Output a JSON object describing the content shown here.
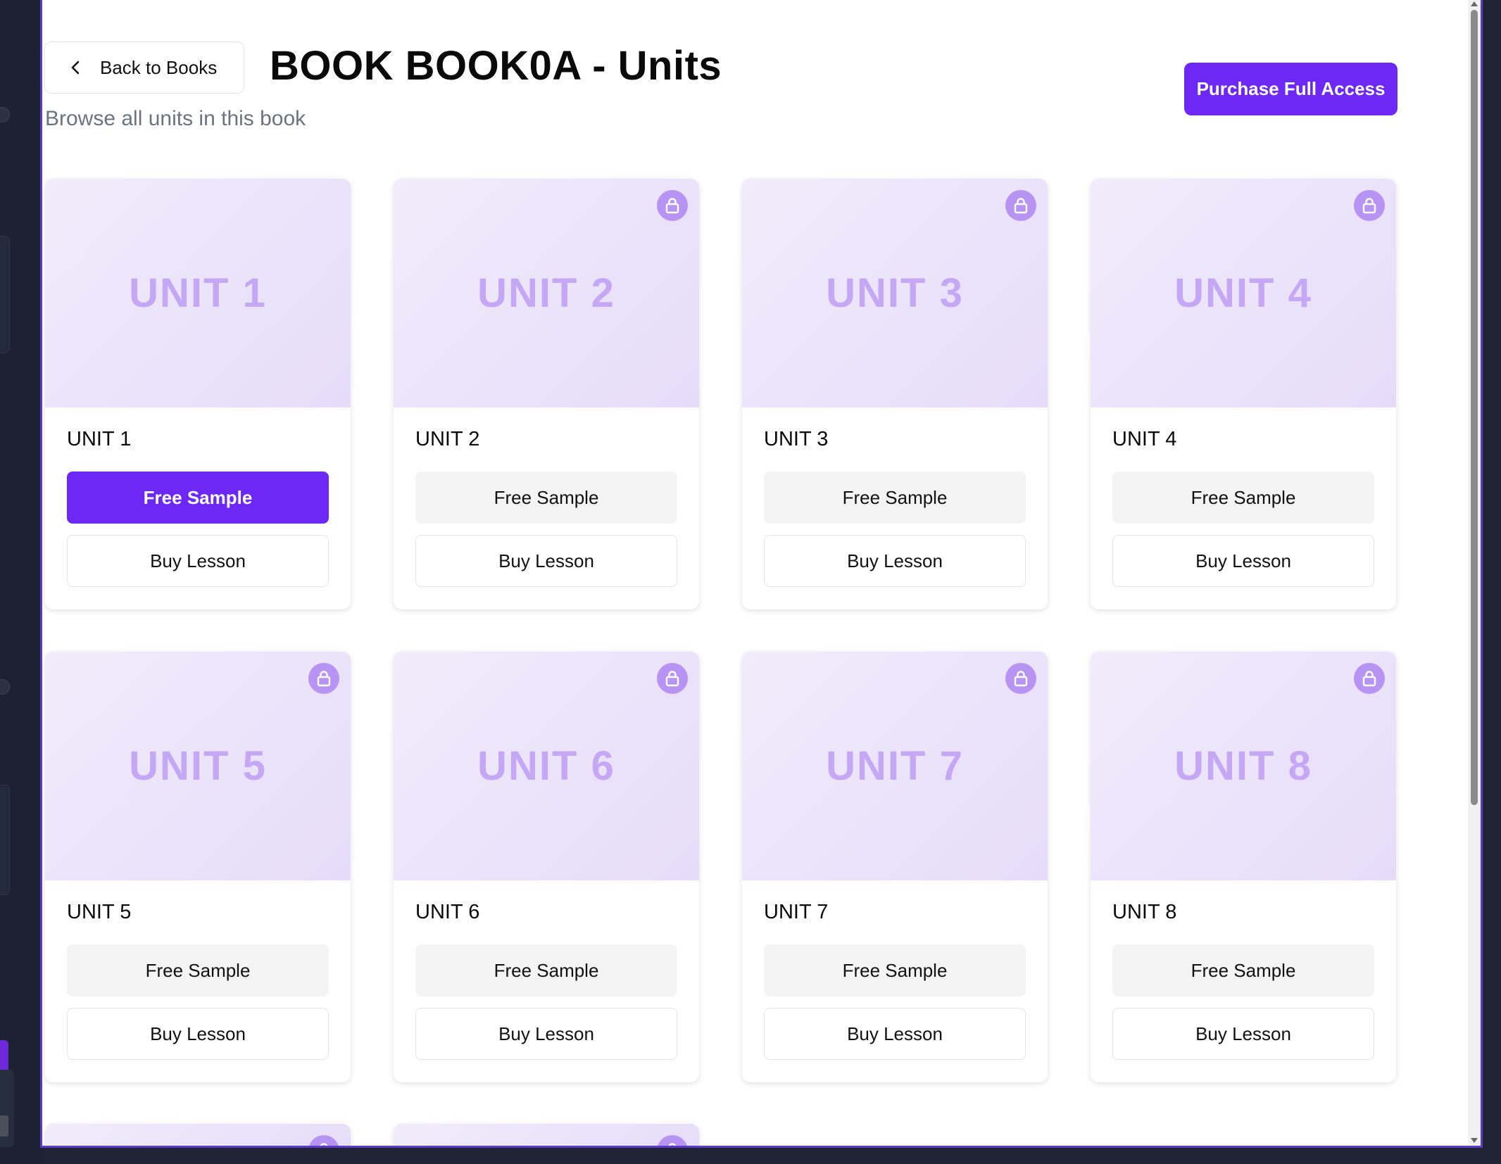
{
  "header": {
    "back_label": "Back to Books",
    "title": "BOOK BOOK0A  - Units",
    "subtitle": "Browse all units in this book",
    "purchase_label": "Purchase Full Access"
  },
  "colors": {
    "accent": "#6d28f5",
    "thumb_text": "#c4a7f5",
    "lock_bg": "#b794f4"
  },
  "units": [
    {
      "thumb": "UNIT 1",
      "title": "UNIT 1",
      "locked": false,
      "sample_active": true,
      "sample_label": "Free Sample",
      "buy_label": "Buy Lesson"
    },
    {
      "thumb": "UNIT 2",
      "title": "UNIT 2",
      "locked": true,
      "sample_active": false,
      "sample_label": "Free Sample",
      "buy_label": "Buy Lesson"
    },
    {
      "thumb": "UNIT 3",
      "title": "UNIT 3",
      "locked": true,
      "sample_active": false,
      "sample_label": "Free Sample",
      "buy_label": "Buy Lesson"
    },
    {
      "thumb": "UNIT 4",
      "title": "UNIT 4",
      "locked": true,
      "sample_active": false,
      "sample_label": "Free Sample",
      "buy_label": "Buy Lesson"
    },
    {
      "thumb": "UNIT 5",
      "title": "UNIT 5",
      "locked": true,
      "sample_active": false,
      "sample_label": "Free Sample",
      "buy_label": "Buy Lesson"
    },
    {
      "thumb": "UNIT 6",
      "title": "UNIT 6",
      "locked": true,
      "sample_active": false,
      "sample_label": "Free Sample",
      "buy_label": "Buy Lesson"
    },
    {
      "thumb": "UNIT 7",
      "title": "UNIT 7",
      "locked": true,
      "sample_active": false,
      "sample_label": "Free Sample",
      "buy_label": "Buy Lesson"
    },
    {
      "thumb": "UNIT 8",
      "title": "UNIT 8",
      "locked": true,
      "sample_active": false,
      "sample_label": "Free Sample",
      "buy_label": "Buy Lesson"
    }
  ]
}
